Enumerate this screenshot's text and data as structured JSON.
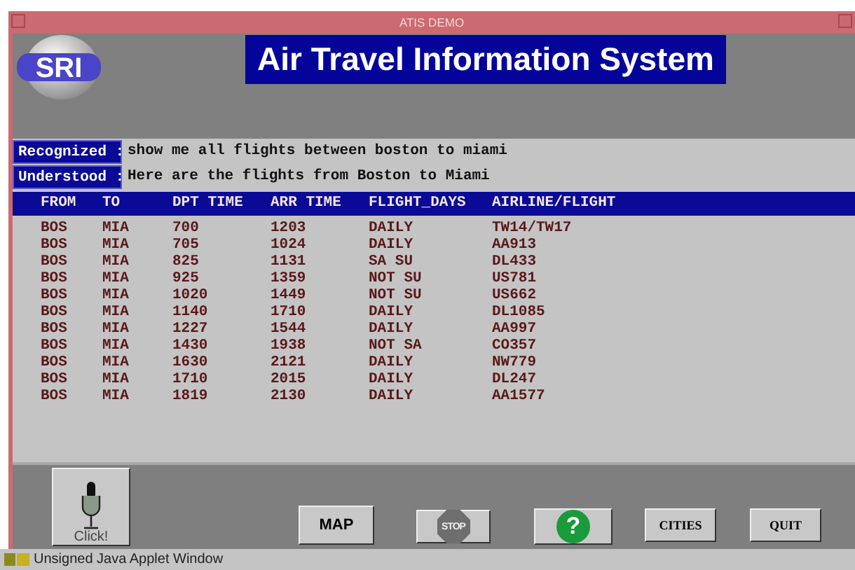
{
  "window": {
    "title": "ATIS DEMO"
  },
  "logo": {
    "text": "SRI"
  },
  "header": {
    "title": "Air Travel Information System"
  },
  "dialogue": [
    {
      "label": "Recognized :",
      "text": "show me all flights between boston to miami"
    },
    {
      "label": "Understood :",
      "text": "Here are the flights from Boston to Miami"
    }
  ],
  "table": {
    "columns": [
      "FROM",
      "TO",
      "DPT TIME",
      "ARR TIME",
      "FLIGHT_DAYS",
      "AIRLINE/FLIGHT"
    ],
    "rows": [
      [
        "BOS",
        "MIA",
        "700",
        "1203",
        "DAILY",
        "TW14/TW17"
      ],
      [
        "BOS",
        "MIA",
        "705",
        "1024",
        "DAILY",
        "AA913"
      ],
      [
        "BOS",
        "MIA",
        "825",
        "1131",
        "SA SU",
        "DL433"
      ],
      [
        "BOS",
        "MIA",
        "925",
        "1359",
        "NOT SU",
        "US781"
      ],
      [
        "BOS",
        "MIA",
        "1020",
        "1449",
        "NOT SU",
        "US662"
      ],
      [
        "BOS",
        "MIA",
        "1140",
        "1710",
        "DAILY",
        "DL1085"
      ],
      [
        "BOS",
        "MIA",
        "1227",
        "1544",
        "DAILY",
        "AA997"
      ],
      [
        "BOS",
        "MIA",
        "1430",
        "1938",
        "NOT SA",
        "CO357"
      ],
      [
        "BOS",
        "MIA",
        "1630",
        "2121",
        "DAILY",
        "NW779"
      ],
      [
        "BOS",
        "MIA",
        "1710",
        "2015",
        "DAILY",
        "DL247"
      ],
      [
        "BOS",
        "MIA",
        "1819",
        "2130",
        "DAILY",
        "AA1577"
      ]
    ]
  },
  "mic_button": {
    "label": "Click!"
  },
  "buttons": [
    {
      "kind": "text",
      "label": "MAP"
    },
    {
      "kind": "stop",
      "label": "STOP"
    },
    {
      "kind": "help",
      "label": "?"
    },
    {
      "kind": "small",
      "label": "CITIES"
    },
    {
      "kind": "small",
      "label": "QUIT"
    }
  ],
  "status_bar": {
    "text": "Unsigned Java Applet Window"
  }
}
